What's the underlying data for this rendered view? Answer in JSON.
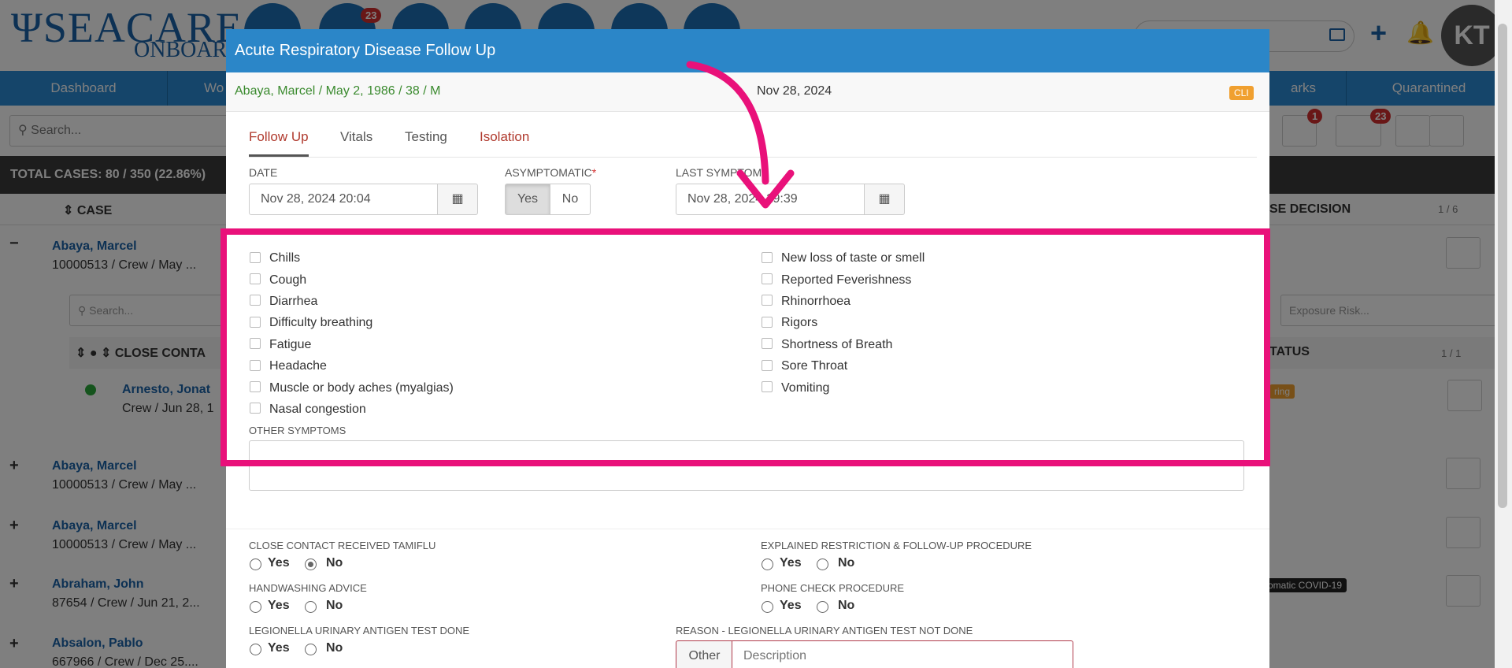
{
  "app": {
    "logo_main": "SEACARE",
    "logo_sub": "ONBOARD",
    "badges": {
      "messages": "23",
      "filter_count": "1",
      "list_count": "23"
    },
    "avatar_initials": "KT"
  },
  "nav": [
    "Dashboard",
    "Wo",
    "arks",
    "Quarantined"
  ],
  "search": {
    "placeholder": "Search..."
  },
  "total_cases": "TOTAL CASES: 80 / 350 (22.86%)",
  "table": {
    "case_header": "CASE",
    "decision_header": "SE DECISION",
    "pager": "1 / 6",
    "close_contact_header": "CLOSE CONTA",
    "status_header": "TATUS",
    "sub_pager": "1 / 1",
    "sub_search_placeholder": "Search...",
    "exposure_placeholder": "Exposure Risk...",
    "rows": [
      {
        "sign": "−",
        "name": "Abaya, Marcel",
        "sub": "10000513 / Crew / May ..."
      },
      {
        "sign": "+",
        "name": "Abaya, Marcel",
        "sub": "10000513 / Crew / May ..."
      },
      {
        "sign": "+",
        "name": "Abaya, Marcel",
        "sub": "10000513 / Crew / May ..."
      },
      {
        "sign": "+",
        "name": "Abraham, John",
        "sub": "87654 / Crew / Jun 21, 2..."
      },
      {
        "sign": "+",
        "name": "Absalon, Pablo",
        "sub": "667966 / Crew / Dec 25...."
      }
    ],
    "contact": {
      "name": "Arnesto, Jonat",
      "sub": "Crew / Jun 28, 1"
    },
    "status_tag": "ring",
    "status_tag2": "omatic COVID-19"
  },
  "modal": {
    "title": "Acute Respiratory Disease Follow Up",
    "patient": "Abaya, Marcel / May 2, 1986 / 38 / M",
    "date": "Nov 28, 2024",
    "cli_badge": "CLI",
    "tabs": [
      "Follow Up",
      "Vitals",
      "Testing",
      "Isolation"
    ],
    "date_label": "DATE",
    "date_value": "Nov 28, 2024 20:04",
    "asymptomatic_label": "ASYMPTOMATIC",
    "asym_yes": "Yes",
    "asym_no": "No",
    "last_symptoms_label": "LAST SYMPTOMS",
    "last_symptoms_value": "Nov 28, 2024 19:39",
    "symptoms_left": [
      "Chills",
      "Cough",
      "Diarrhea",
      "Difficulty breathing",
      "Fatigue",
      "Headache",
      "Muscle or body aches (myalgias)",
      "Nasal congestion"
    ],
    "symptoms_right": [
      "New loss of taste or smell",
      "Reported Feverishness",
      "Rhinorrhoea",
      "Rigors",
      "Shortness of Breath",
      "Sore Throat",
      "Vomiting"
    ],
    "other_symptoms_label": "OTHER SYMPTOMS",
    "questions": {
      "tamiflu": "CLOSE CONTACT RECEIVED TAMIFLU",
      "explained": "EXPLAINED RESTRICTION & FOLLOW-UP PROCEDURE",
      "handwashing": "HANDWASHING ADVICE",
      "phone": "PHONE CHECK PROCEDURE",
      "legionella": "LEGIONELLA URINARY ANTIGEN TEST DONE",
      "reason": "REASON - LEGIONELLA URINARY ANTIGEN TEST NOT DONE"
    },
    "yes": "Yes",
    "no": "No",
    "reason_prefix": "Other",
    "reason_placeholder": "Description"
  },
  "colors": {
    "accent": "#2b86c8",
    "highlight": "#e9117a",
    "patient_text": "#3a8a2e",
    "isolation_tab": "#b03a2e"
  }
}
